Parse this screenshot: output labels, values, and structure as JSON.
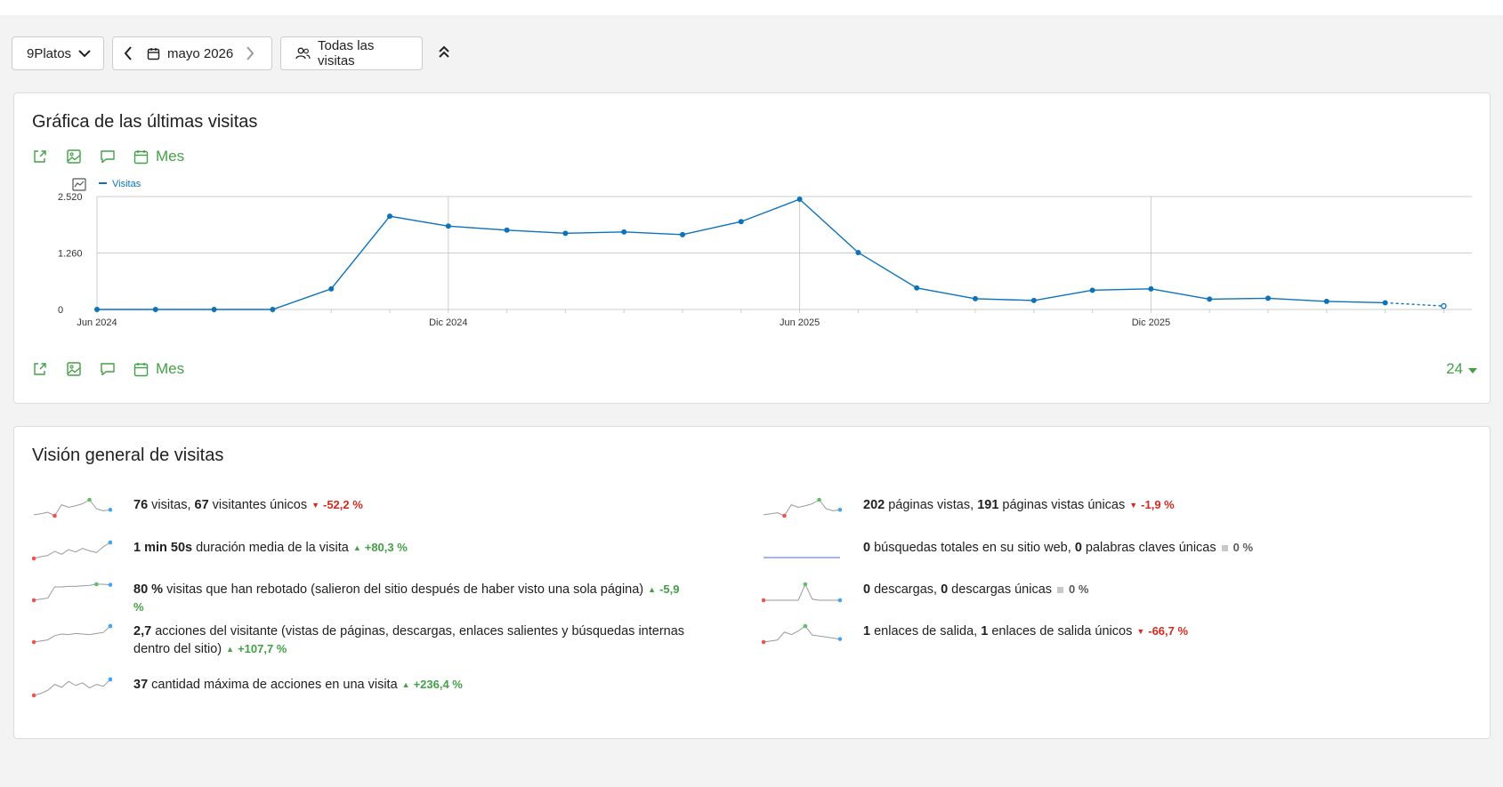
{
  "toolbar": {
    "site": "9Platos",
    "date": "mayo 2026",
    "segment": "Todas las visitas"
  },
  "graph_card": {
    "title": "Gráfica de las últimas visitas",
    "period_label": "Mes",
    "limit_value": "24",
    "icons": [
      "export-icon",
      "image-icon",
      "annotation-icon",
      "calendar-icon"
    ]
  },
  "chart_data": {
    "type": "line",
    "x": [
      "2024-06",
      "2024-07",
      "2024-08",
      "2024-09",
      "2024-10",
      "2024-11",
      "2024-12",
      "2025-01",
      "2025-02",
      "2025-03",
      "2025-04",
      "2025-05",
      "2025-06",
      "2025-07",
      "2025-08",
      "2025-09",
      "2025-10",
      "2025-11",
      "2025-12",
      "2026-01",
      "2026-02",
      "2026-03",
      "2026-04",
      "2026-05"
    ],
    "series": [
      {
        "name": "Visitas",
        "color": "#0b72bb",
        "values": [
          0,
          0,
          0,
          0,
          460,
          2080,
          1860,
          1770,
          1700,
          1730,
          1670,
          1960,
          2460,
          1270,
          480,
          240,
          200,
          430,
          460,
          230,
          250,
          180,
          150,
          76
        ]
      }
    ],
    "x_tick_labels": [
      "Jun 2024",
      "Dic 2024",
      "Jun 2025",
      "Dic 2025"
    ],
    "y_tick_labels": [
      "2.520",
      "1.260",
      "0"
    ],
    "ylim": [
      0,
      2520
    ],
    "last_point_incomplete": true,
    "grid": true,
    "legend": "top-left"
  },
  "overview_card": {
    "title": "Visión general de visitas",
    "left": [
      {
        "v1": "76",
        "t1": " visitas, ",
        "v2": "67",
        "t2": " visitantes únicos",
        "change": "-52,2 %",
        "dir": "down",
        "spark": [
          40,
          42,
          45,
          38,
          60,
          55,
          58,
          62,
          70,
          52,
          48,
          50
        ],
        "hi": 7,
        "lo": 0
      },
      {
        "v1": "1 min 50s",
        "t1": " duración media de la visita",
        "v2": "",
        "t2": "",
        "change": "+80,3 %",
        "dir": "up",
        "spark": [
          35,
          38,
          40,
          47,
          42,
          50,
          46,
          52,
          48,
          45,
          55,
          62
        ],
        "hi": 11,
        "lo": 0
      },
      {
        "v1": "80 %",
        "t1": " visitas que han rebotado (salieron del sitio después de haber visto una sola página)",
        "v2": "",
        "t2": "",
        "change": "-5,9 %",
        "dir": "up",
        "spark": [
          30,
          32,
          34,
          55,
          55,
          56,
          56,
          57,
          58,
          60,
          60,
          59
        ],
        "hi": 9,
        "lo": 0
      },
      {
        "v1": "2,7",
        "t1": " acciones del visitante (vistas de páginas, descargas, enlaces salientes y búsquedas internas dentro del sitio)",
        "v2": "",
        "t2": "",
        "change": "+107,7 %",
        "dir": "up",
        "spark": [
          30,
          32,
          34,
          42,
          45,
          44,
          46,
          45,
          44,
          46,
          48,
          60
        ],
        "hi": 11,
        "lo": 0
      },
      {
        "v1": "37",
        "t1": " cantidad máxima de acciones en una visita",
        "v2": "",
        "t2": "",
        "change": "+236,4 %",
        "dir": "up",
        "spark": [
          30,
          34,
          40,
          52,
          46,
          58,
          50,
          55,
          45,
          52,
          48,
          62
        ],
        "hi": 11,
        "lo": 0
      }
    ],
    "right": [
      {
        "v1": "202",
        "t1": " páginas vistas, ",
        "v2": "191",
        "t2": " páginas vistas únicas",
        "change": "-1,9 %",
        "dir": "down",
        "spark": [
          40,
          42,
          44,
          38,
          60,
          55,
          58,
          62,
          70,
          52,
          48,
          50
        ],
        "hi": 7,
        "lo": 0
      },
      {
        "v1": "0",
        "t1": " búsquedas totales en su sitio web, ",
        "v2": "0",
        "t2": " palabras claves únicas",
        "change": "0 %",
        "dir": "flat",
        "spark": [
          30,
          30,
          30,
          30,
          30,
          30,
          30,
          30,
          30,
          30,
          30,
          30
        ],
        "hi": -1,
        "lo": -1
      },
      {
        "v1": "0",
        "t1": " descargas, ",
        "v2": "0",
        "t2": " descargas únicas",
        "change": "0 %",
        "dir": "flat",
        "spark": [
          30,
          30,
          30,
          30,
          30,
          30,
          60,
          32,
          30,
          30,
          30,
          30
        ],
        "hi": 6,
        "lo": 0
      },
      {
        "v1": "1",
        "t1": " enlaces de salida, ",
        "v2": "1",
        "t2": " enlaces de salida únicos",
        "change": "-66,7 %",
        "dir": "down",
        "spark": [
          30,
          32,
          34,
          50,
          45,
          52,
          62,
          44,
          42,
          40,
          38,
          36
        ],
        "hi": 6,
        "lo": 0
      }
    ]
  }
}
